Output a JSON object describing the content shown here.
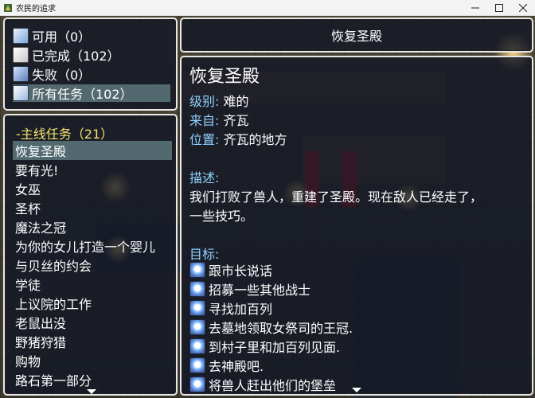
{
  "window": {
    "title": "农民的追求"
  },
  "categories": [
    {
      "label": "可用（0）",
      "icon": "open-quest-icon"
    },
    {
      "label": "已完成（102）",
      "icon": "completed-quest-icon"
    },
    {
      "label": "失败（0）",
      "icon": "failed-quest-icon"
    },
    {
      "label": "所有任务（102）",
      "icon": "all-quests-icon",
      "selected": true
    }
  ],
  "quest_list": {
    "group_title": "-主线任务（21）",
    "items": [
      "恢复圣殿",
      "要有光!",
      "女巫",
      "圣杯",
      "魔法之冠",
      "为你的女儿打造一个婴儿",
      "与贝丝的约会",
      "学徒",
      "上议院的工作",
      "老鼠出没",
      "野猪狩猎",
      "购物",
      "路石第一部分"
    ],
    "selected_index": 0
  },
  "header": {
    "title": "恢复圣殿"
  },
  "detail": {
    "title": "恢复圣殿",
    "rank_label": "级别:",
    "rank_value": "难的",
    "from_label": "来自:",
    "from_value": "齐瓦",
    "location_label": "位置:",
    "location_value": "齐瓦的地方",
    "description_label": "描述:",
    "description_line1": "我们打败了兽人，重建了圣殿。现在敌人已经走了，",
    "description_line2": "一些技巧。",
    "objectives_label": "目标:",
    "objectives": [
      "跟市长说话",
      "招募一些其他战士",
      "寻找加百列",
      "去墓地领取女祭司的王冠.",
      "到村子里和加百列见面.",
      "去神殿吧.",
      "将兽人赶出他们的堡垒"
    ]
  }
}
